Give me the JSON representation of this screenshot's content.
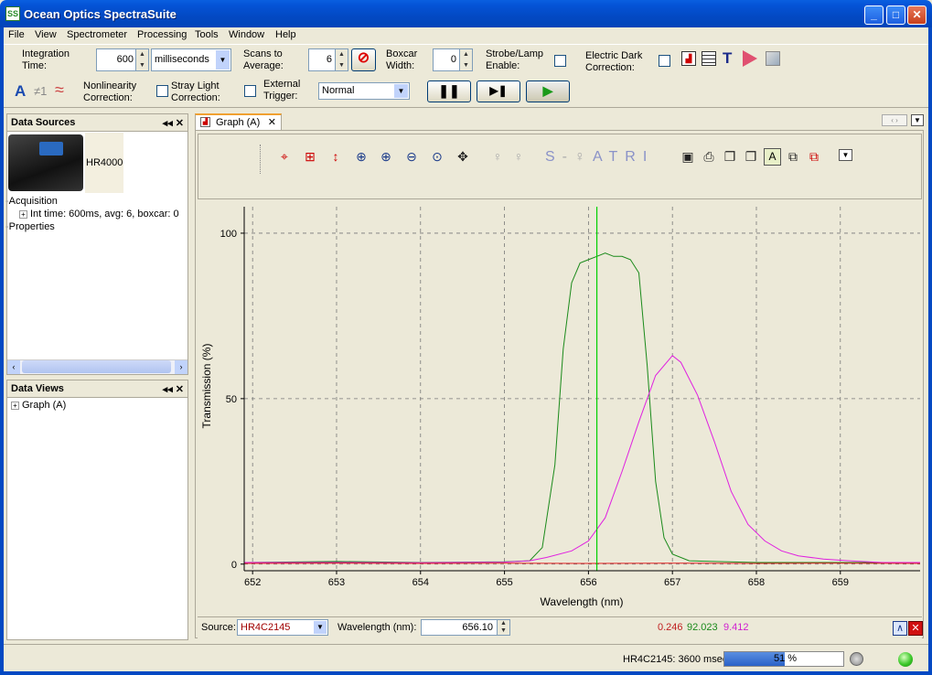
{
  "window": {
    "title": "Ocean Optics SpectraSuite",
    "app_icon": "SS"
  },
  "menu": [
    "File",
    "View",
    "Spectrometer",
    "Processing",
    "Tools",
    "Window",
    "Help"
  ],
  "toolbar": {
    "integration_label": "Integration Time:",
    "integration_value": "600",
    "integration_unit": "milliseconds",
    "scans_label": "Scans to Average:",
    "scans_value": "6",
    "boxcar_label": "Boxcar Width:",
    "boxcar_value": "0",
    "strobe_label": "Strobe/Lamp Enable:",
    "dark_label": "Electric Dark Correction:",
    "nonlin_label": "Nonlinearity Correction:",
    "stray_label": "Stray Light Correction:",
    "trigger_label": "External Trigger:",
    "trigger_value": "Normal",
    "icons_row2": [
      "A",
      "≠1",
      "≈"
    ]
  },
  "data_sources": {
    "title": "Data Sources",
    "device": "HR4000",
    "acquisition": "Acquisition",
    "acq_detail": "Int time: 600ms, avg: 6, boxcar: 0",
    "properties": "Properties"
  },
  "data_views": {
    "title": "Data Views",
    "item": "Graph (A)"
  },
  "graph_tab": {
    "label": "Graph (A)"
  },
  "graph_toolbar_letters": [
    "S",
    "A",
    "T",
    "R",
    "I"
  ],
  "graph_footer": {
    "source_label": "Source:",
    "source_value": "HR4C2145",
    "wavelength_label": "Wavelength (nm):",
    "wavelength_value": "656.10",
    "readout_red": "0.246",
    "readout_green": "92.023",
    "readout_magenta": "9.412"
  },
  "status": {
    "text": "HR4C2145: 3600 msec",
    "progress": 0.51,
    "progress_label": "51 %"
  },
  "chart_data": {
    "type": "line",
    "xlabel": "Wavelength (nm)",
    "ylabel": "Transmission (%)",
    "xlim": [
      651.9,
      659.95
    ],
    "ylim": [
      -2,
      108
    ],
    "xticks": [
      652,
      653,
      654,
      655,
      656,
      657,
      658,
      659
    ],
    "yticks": [
      0,
      50,
      100
    ],
    "cursor_x": 656.1,
    "colors": {
      "green": "#1a8a1a",
      "magenta": "#e020e0",
      "red": "#e02020",
      "cursor": "#00d000"
    },
    "series": [
      {
        "color": "#1a8a1a",
        "x": [
          651.9,
          653,
          654,
          655,
          655.3,
          655.45,
          655.6,
          655.7,
          655.8,
          655.9,
          656.0,
          656.1,
          656.2,
          656.3,
          656.4,
          656.5,
          656.6,
          656.7,
          656.8,
          656.9,
          657.0,
          657.2,
          657.5,
          658,
          659,
          659.95
        ],
        "y": [
          0.5,
          0.8,
          0.5,
          0.7,
          1,
          5,
          30,
          65,
          85,
          91,
          92,
          93,
          94,
          93,
          93,
          92,
          88,
          60,
          25,
          8,
          3,
          1,
          0.8,
          0.5,
          0.5,
          0.5
        ]
      },
      {
        "color": "#e020e0",
        "x": [
          651.9,
          653,
          654,
          655,
          655.3,
          655.5,
          655.8,
          656.0,
          656.2,
          656.4,
          656.6,
          656.8,
          657.0,
          657.1,
          657.3,
          657.5,
          657.7,
          657.9,
          658.1,
          658.3,
          658.5,
          658.8,
          659.1,
          659.5,
          659.95
        ],
        "y": [
          0.5,
          0.5,
          0.4,
          0.6,
          1,
          2,
          4,
          7,
          14,
          28,
          43,
          57,
          63,
          61,
          51,
          37,
          22,
          12,
          7,
          4,
          2.5,
          1.5,
          1,
          0.5,
          0.5
        ]
      },
      {
        "color": "#e02020",
        "x": [
          651.9,
          653,
          654,
          655,
          656,
          657,
          658,
          659,
          659.95
        ],
        "y": [
          0.2,
          0.3,
          0.2,
          0.3,
          0.2,
          0.3,
          0.2,
          0.3,
          0.2
        ]
      }
    ]
  }
}
